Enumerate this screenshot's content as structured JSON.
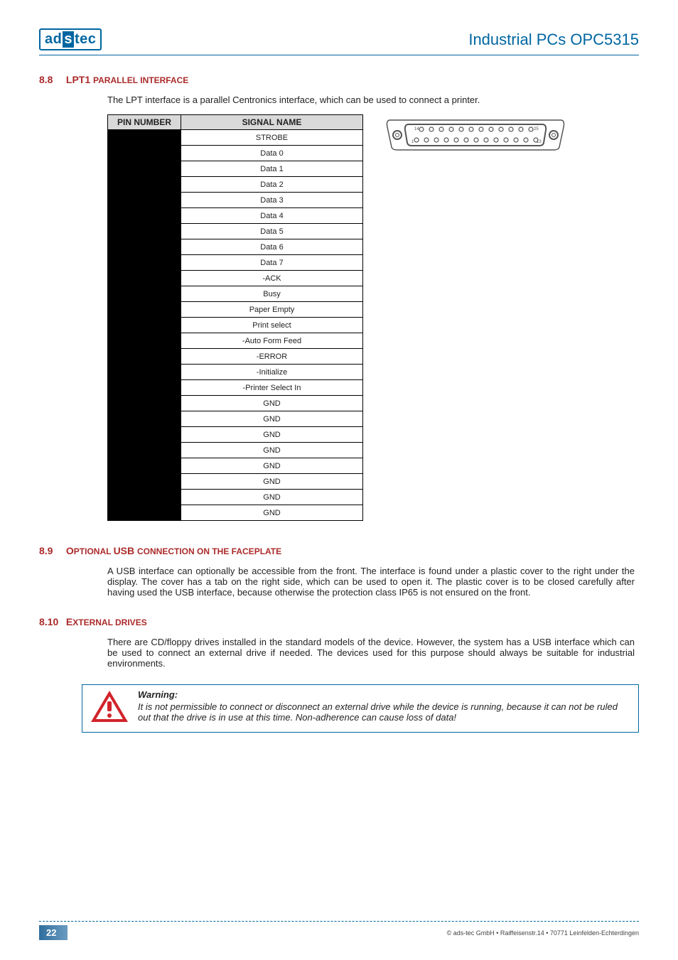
{
  "logo_segments": [
    "ad",
    "s",
    "tec"
  ],
  "header_title": "Industrial PCs OPC5315",
  "section_8_8": {
    "num": "8.8",
    "title_parts": [
      "LPT1 ",
      "PARALLEL INTERFACE"
    ],
    "intro": "The LPT interface is a parallel Centronics interface, which can be used to connect a printer.",
    "pin_header_1": "PIN NUMBER",
    "pin_header_2": "SIGNAL NAME",
    "signals": [
      "STROBE",
      "Data 0",
      "Data 1",
      "Data 2",
      "Data 3",
      "Data 4",
      "Data 5",
      "Data 6",
      "Data 7",
      "-ACK",
      "Busy",
      "Paper Empty",
      "Print select",
      "-Auto Form Feed",
      "-ERROR",
      "-Initialize",
      "-Printer Select In",
      "GND",
      "GND",
      "GND",
      "GND",
      "GND",
      "GND",
      "GND",
      "GND"
    ],
    "connector_labels": {
      "left_top": "14",
      "right_top": "25",
      "left_bot": "1",
      "right_bot": "13"
    }
  },
  "section_8_9": {
    "num": "8.9",
    "title_parts": [
      "O",
      "PTIONAL ",
      " USB ",
      "CONNECTION ON THE FACEPLATE"
    ],
    "body": "A USB interface can optionally be accessible from the front. The interface is found under a plastic cover to the right under the display. The cover has a tab on the right side, which can be used to open it. The plastic cover is to be closed carefully after having used the USB interface, because otherwise the protection class IP65 is not ensured on the front."
  },
  "section_8_10": {
    "num": "8.10",
    "title_parts": [
      "E",
      "XTERNAL DRIVES"
    ],
    "body": "There are CD/floppy drives installed in the standard models of the device. However, the system has a USB interface which can be used to connect an external drive if needed. The devices used for this purpose should always be suitable for industrial environments."
  },
  "warning": {
    "title": "Warning:",
    "body": "It is not permissible to connect or disconnect an external drive while the device is running, because it can not be ruled out that the drive is in use at this time. Non-adherence can cause loss of data!"
  },
  "page_number": "22",
  "footer_copy": "© ads-tec GmbH • Raiffeisenstr.14 • 70771 Leinfelden-Echterdingen"
}
